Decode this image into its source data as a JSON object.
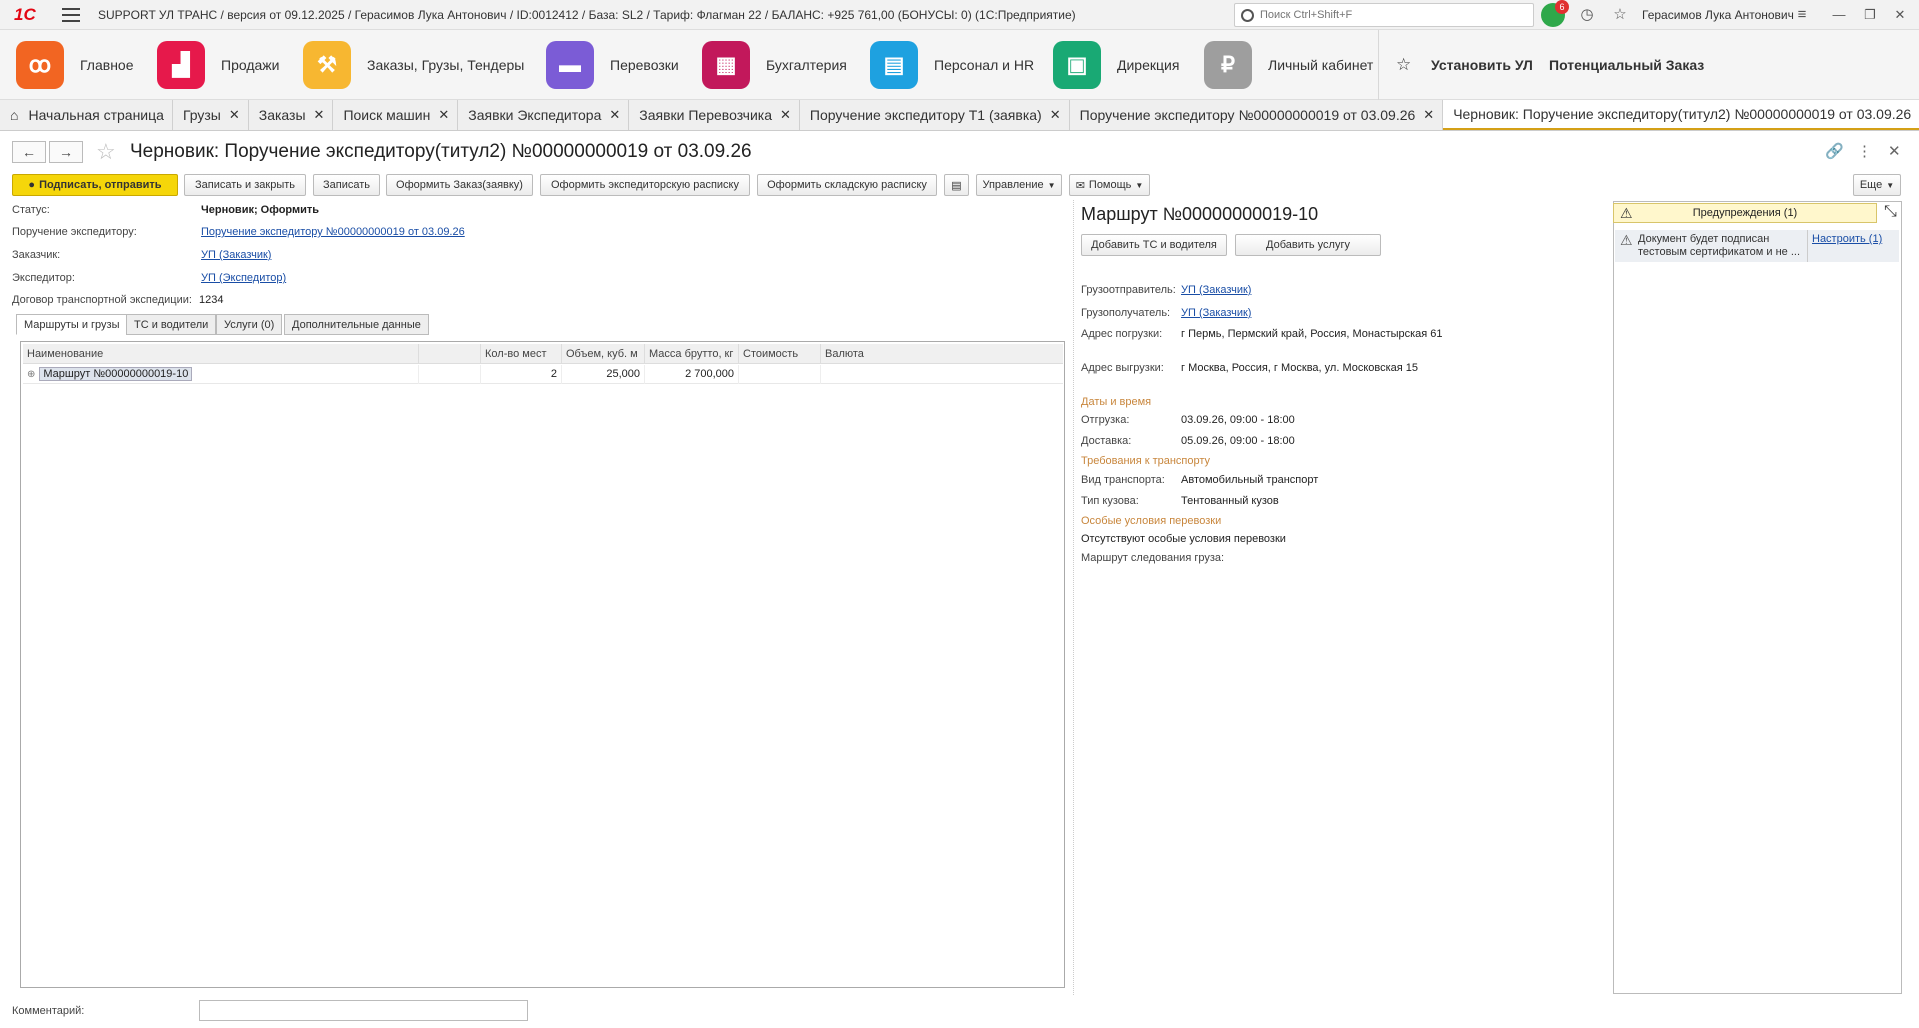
{
  "titlebar": {
    "logo": "1С",
    "title": "SUPPORT УЛ ТРАНС / версия от 09.12.2025 / Герасимов Лука Антонович / ID:0012412 / База: SL2 / Тариф: Флагман 22 / БАЛАНС: +925 761,00 (БОНУСЫ: 0)  (1С:Предприятие)",
    "search_placeholder": "Поиск Ctrl+Shift+F",
    "notifications_count": "6",
    "user": "Герасимов Лука Антонович"
  },
  "sections": [
    {
      "label": "Главное",
      "color": "#f26522",
      "glyph": "ꝏ"
    },
    {
      "label": "Продажи",
      "color": "#e6194b",
      "glyph": "▟"
    },
    {
      "label": "Заказы,  Грузы, Тендеры",
      "color": "#f7b731",
      "glyph": "⚒"
    },
    {
      "label": "Перевозки",
      "color": "#7b5cd6",
      "glyph": "▬"
    },
    {
      "label": "Бухгалтерия",
      "color": "#c2185b",
      "glyph": "▦"
    },
    {
      "label": "Персонал и HR",
      "color": "#1ea1e0",
      "glyph": "▤"
    },
    {
      "label": "Дирекция",
      "color": "#19a974",
      "glyph": "▣"
    },
    {
      "label": "Личный кабинет",
      "color": "#9e9e9e",
      "glyph": "₽"
    }
  ],
  "section_actions": {
    "install": "Установить УЛ",
    "potential": "Потенциальный Заказ"
  },
  "open_tabs": [
    "Начальная страница",
    "Грузы",
    "Заказы",
    "Поиск машин",
    "Заявки Экспедитора",
    "Заявки Перевозчика",
    "Поручение экспедитору Т1 (заявка)",
    "Поручение экспедитору №00000000019 от 03.09.26",
    "Черновик: Поручение экспедитору(титул2) №00000000019 от 03.09.26"
  ],
  "document": {
    "title": "Черновик: Поручение экспедитору(титул2) №00000000019 от 03.09.26"
  },
  "commands": {
    "sign": "Подписать, отправить",
    "save_close": "Записать и закрыть",
    "save": "Записать",
    "order": "Оформить Заказ(заявку)",
    "forwarder_receipt": "Оформить экспедиторскую расписку",
    "warehouse_receipt": "Оформить складскую расписку",
    "manage": "Управление",
    "help": "Помощь",
    "more": "Еще"
  },
  "fields": {
    "status_label": "Статус:",
    "status_value": "Черновик; Оформить",
    "order_label": "Поручение экспедитору:",
    "order_value": "Поручение экспедитору №00000000019 от 03.09.26",
    "customer_label": "Заказчик:",
    "customer_value": "УП (Заказчик)",
    "forwarder_label": "Экспедитор:",
    "forwarder_value": "УП (Экспедитор)",
    "contract_label": "Договор транспортной экспедиции:",
    "contract_value": "1234"
  },
  "inner_tabs": [
    "Маршруты и грузы",
    "ТС и водители",
    "Услуги (0)",
    "Дополнительные данные"
  ],
  "table": {
    "columns": [
      "Наименование",
      "",
      "Кол-во мест",
      "Объем, куб. м",
      "Масса брутто, кг",
      "Стоимость",
      "Валюта"
    ],
    "rows": [
      {
        "name": "Маршрут №00000000019-10",
        "places": "2",
        "volume": "25,000",
        "mass": "2 700,000",
        "cost": "",
        "currency": ""
      }
    ]
  },
  "comment": {
    "label": "Комментарий:",
    "value": ""
  },
  "route": {
    "title": "Маршрут №00000000019-10",
    "add_vehicle": "Добавить ТС и водителя",
    "add_service": "Добавить услугу",
    "shipper_label": "Грузоотправитель:",
    "shipper_value": "УП (Заказчик)",
    "consignee_label": "Грузополучатель:",
    "consignee_value": "УП (Заказчик)",
    "load_addr_label": "Адрес погрузки:",
    "load_addr_value": "г Пермь, Пермский край, Россия, Монастырская 61",
    "unload_addr_label": "Адрес выгрузки:",
    "unload_addr_value": "г Москва, Россия, г Москва, ул. Московская 15",
    "dates_section": "Даты и время",
    "shipment_label": "Отгрузка:",
    "shipment_value": "03.09.26, 09:00 - 18:00",
    "delivery_label": "Доставка:",
    "delivery_value": "05.09.26, 09:00 - 18:00",
    "transport_section": "Требования к транспорту",
    "transport_kind_label": "Вид транспорта:",
    "transport_kind_value": "Автомобильный транспорт",
    "body_type_label": "Тип кузова:",
    "body_type_value": "Тентованный кузов",
    "conditions_section": "Особые условия перевозки",
    "conditions_value": "Отсутствуют особые условия перевозки",
    "route_path_label": "Маршрут следования груза:"
  },
  "warnings": {
    "header": "Предупреждения (1)",
    "message": "Документ будет подписан тестовым сертификатом и не ...",
    "configure": "Настроить (1)"
  }
}
